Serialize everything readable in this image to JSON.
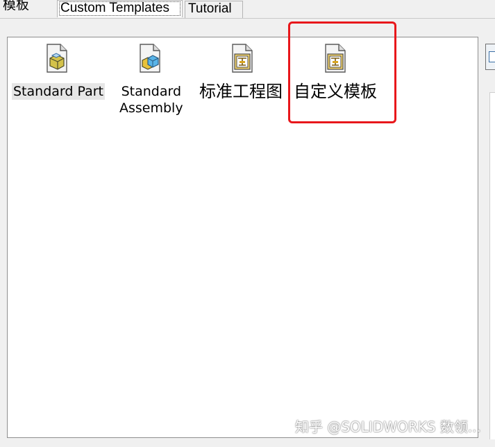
{
  "tabs": [
    {
      "label": "模板",
      "state": "plain"
    },
    {
      "label": "Custom Templates",
      "state": "active"
    },
    {
      "label": "Tutorial",
      "state": "inactive"
    }
  ],
  "templates": [
    {
      "label": "Standard Part",
      "icon": "part-document-icon",
      "selected": true
    },
    {
      "label": "Standard\nAssembly",
      "icon": "assembly-document-icon",
      "selected": false
    },
    {
      "label": "标准工程图",
      "icon": "drawing-document-icon",
      "selected": false
    },
    {
      "label": "自定义模板",
      "icon": "drawing-document-icon",
      "selected": false
    }
  ],
  "highlight_color": "#e8171b",
  "watermark": "知乎 @SOLIDWORKS 数领..."
}
